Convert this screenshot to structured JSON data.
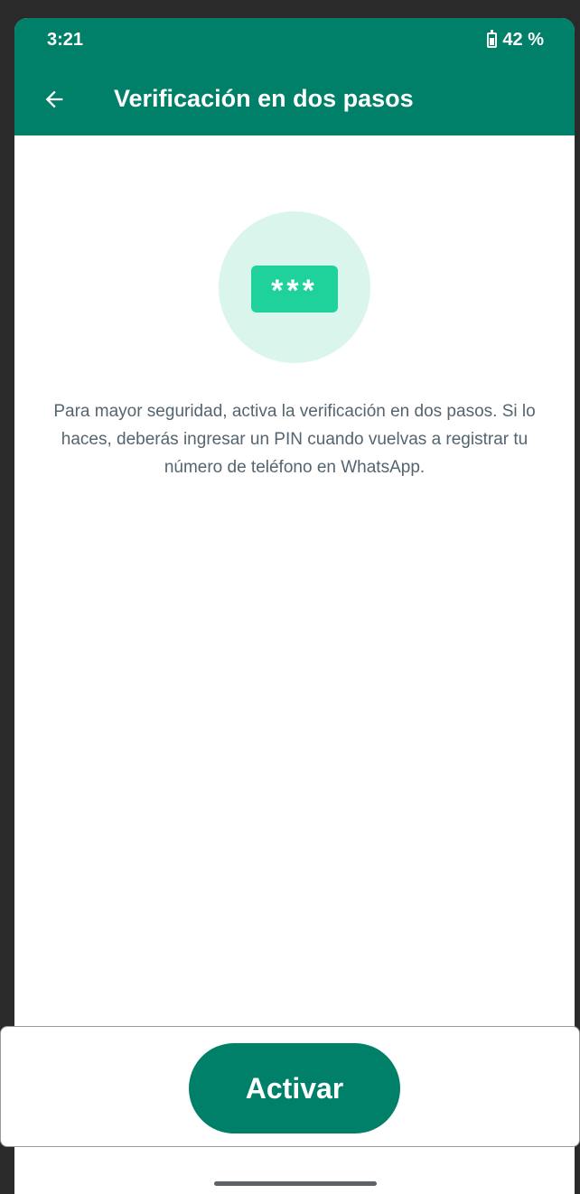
{
  "status_bar": {
    "time": "3:21",
    "battery": "42 %"
  },
  "app_bar": {
    "title": "Verificación en dos pasos",
    "back_icon": "arrow-left-icon"
  },
  "illustration": {
    "pin_text": "***",
    "icon": "pin-code-icon"
  },
  "description": "Para mayor seguridad, activa la verificación en dos pasos. Si lo haces, deberás ingresar un PIN cuando vuelvas a registrar tu número de teléfono en WhatsApp.",
  "action": {
    "activate_label": "Activar"
  },
  "colors": {
    "primary": "#008069",
    "accent": "#1fd19b",
    "illustration_bg": "#d9f5ec",
    "text_secondary": "#54656f"
  }
}
